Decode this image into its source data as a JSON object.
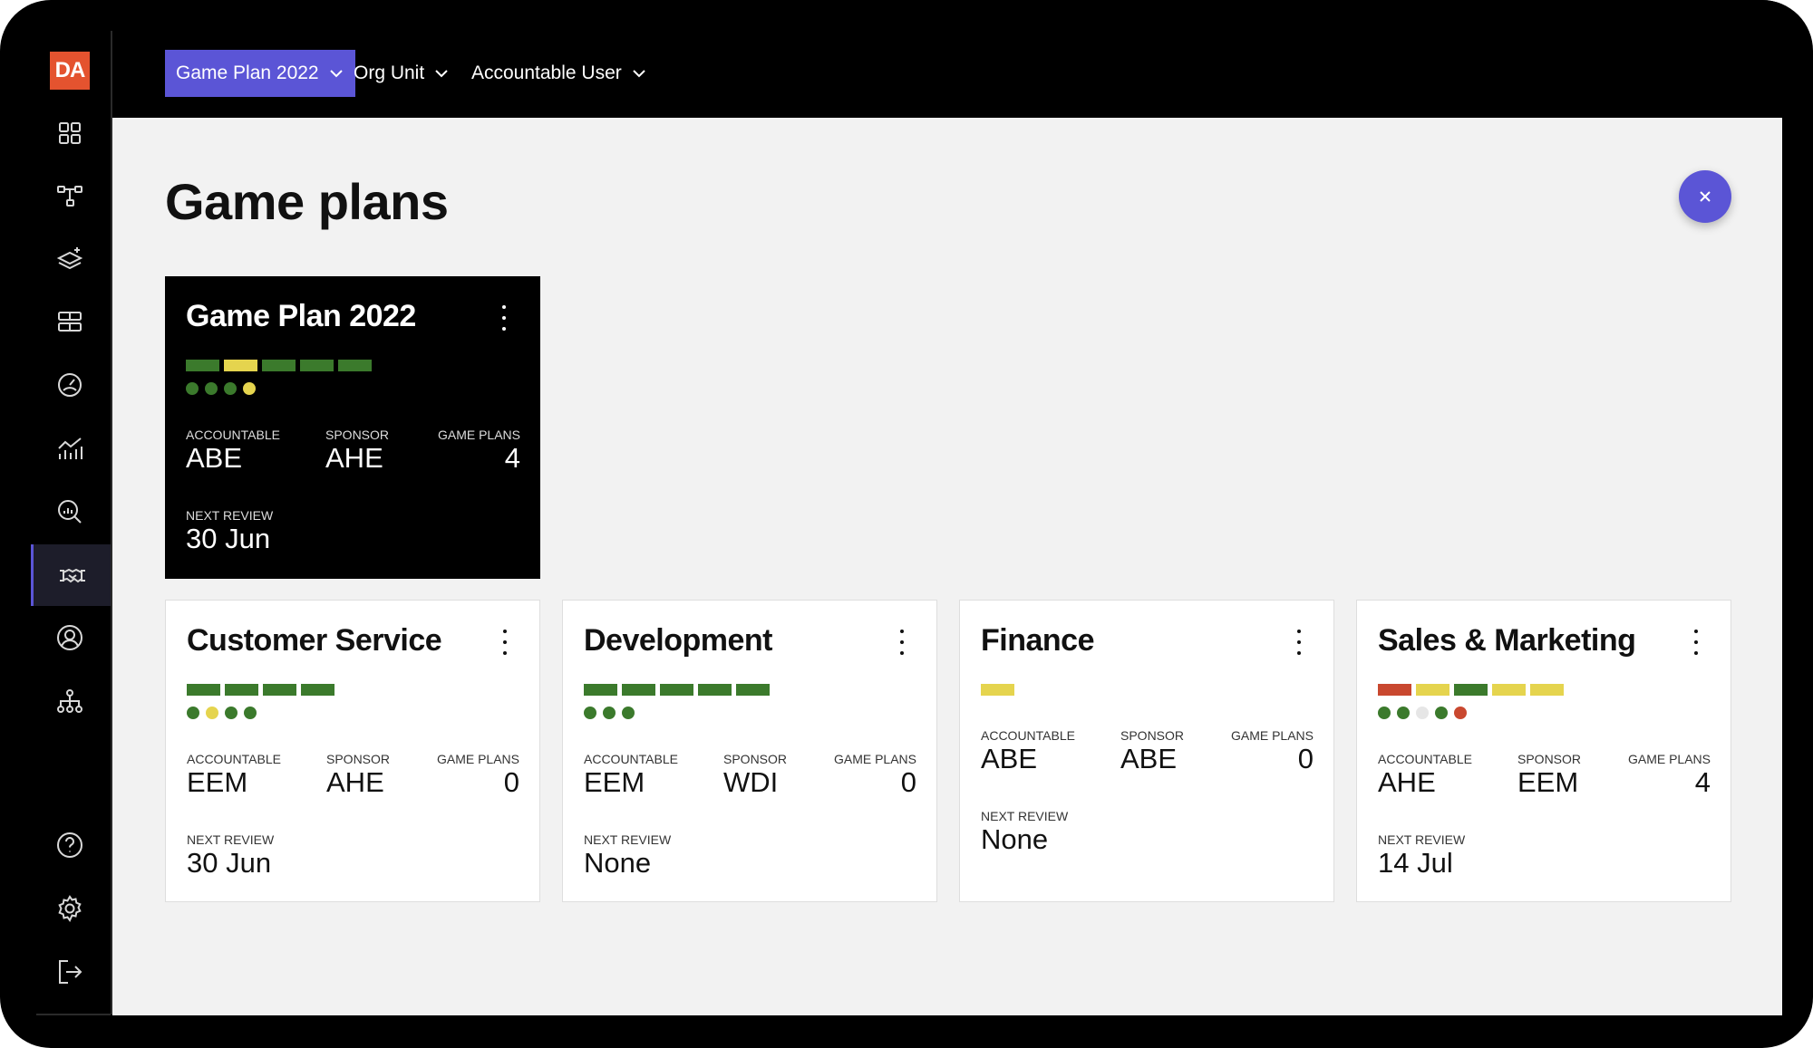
{
  "logo": "DA",
  "filters": [
    {
      "label": "Game Plan 2022",
      "active": true
    },
    {
      "label": "Org Unit",
      "active": false
    },
    {
      "label": "Accountable User",
      "active": false
    }
  ],
  "page_title": "Game plans",
  "labels": {
    "accountable": "ACCOUNTABLE",
    "sponsor": "SPONSOR",
    "game_plans": "GAME PLANS",
    "next_review": "NEXT REVIEW"
  },
  "colors": {
    "green": "#3b7a2c",
    "yellow": "#e5d44e",
    "red": "#c9482f",
    "empty": "#e6e6e6",
    "accent": "#5b55d6"
  },
  "cards": [
    {
      "title": "Game Plan 2022",
      "bars": [
        "green",
        "yellow",
        "green",
        "green",
        "green"
      ],
      "dots": [
        "green",
        "green",
        "green",
        "yellow"
      ],
      "accountable": "ABE",
      "sponsor": "AHE",
      "game_plans": "4",
      "next_review": "30 Jun"
    },
    {
      "title": "Customer Service",
      "bars": [
        "green",
        "green",
        "green",
        "green"
      ],
      "dots": [
        "green",
        "yellow",
        "green",
        "green"
      ],
      "accountable": "EEM",
      "sponsor": "AHE",
      "game_plans": "0",
      "next_review": "30 Jun"
    },
    {
      "title": "Development",
      "bars": [
        "green",
        "green",
        "green",
        "green",
        "green"
      ],
      "dots": [
        "green",
        "green",
        "green"
      ],
      "accountable": "EEM",
      "sponsor": "WDI",
      "game_plans": "0",
      "next_review": "None"
    },
    {
      "title": "Finance",
      "bars": [
        "yellow"
      ],
      "dots": [],
      "accountable": "ABE",
      "sponsor": "ABE",
      "game_plans": "0",
      "next_review": "None"
    },
    {
      "title": "Sales & Marketing",
      "bars": [
        "red",
        "yellow",
        "green",
        "yellow",
        "yellow"
      ],
      "dots": [
        "green",
        "green",
        "empty",
        "green",
        "red"
      ],
      "accountable": "AHE",
      "sponsor": "EEM",
      "game_plans": "4",
      "next_review": "14 Jul"
    }
  ],
  "nav_icons": [
    "grid-icon",
    "network-icon",
    "layers-add-icon",
    "table-icon",
    "gauge-icon",
    "analytics-icon",
    "search-chart-icon",
    "handshake-icon",
    "user-circle-icon",
    "org-chart-icon",
    "help-icon",
    "settings-icon",
    "logout-icon"
  ]
}
